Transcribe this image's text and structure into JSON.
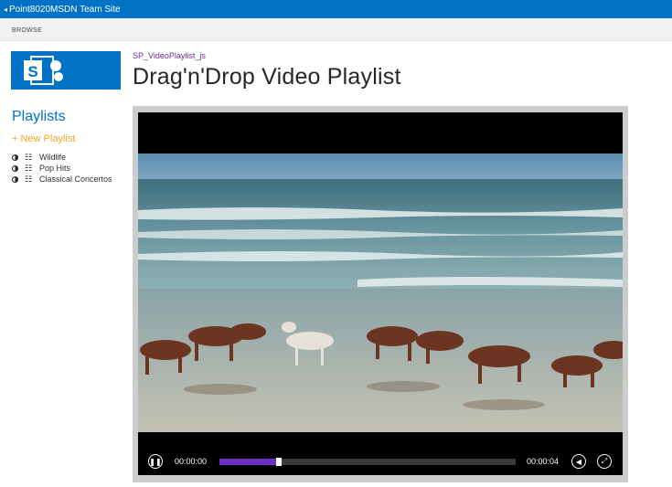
{
  "suite_bar": {
    "back_glyph": "◂",
    "site_title": "Point8020MSDN Team Site"
  },
  "ribbon": {
    "tab_label": "BROWSE"
  },
  "header": {
    "breadcrumb": "SP_VideoPlaylist_js",
    "title": "Drag'n'Drop Video Playlist"
  },
  "logo": {
    "icon": "sharepoint-logo-icon",
    "brand_color": "#0072c6"
  },
  "nav": {
    "heading": "Playlists",
    "new_link": "+ New Playlist",
    "playlists": [
      {
        "label": "Wildlife",
        "play_icon": "play-icon",
        "edit_icon": "edit-playlist-icon"
      },
      {
        "label": "Pop Hits",
        "play_icon": "play-icon",
        "edit_icon": "edit-playlist-icon"
      },
      {
        "label": "Classical Concertos",
        "play_icon": "play-icon",
        "edit_icon": "edit-playlist-icon"
      }
    ]
  },
  "player": {
    "current_time": "00:00:00",
    "duration": "00:00:04",
    "buffered_fraction": 0.19,
    "played_fraction": 0.19,
    "pause_icon": "pause-icon",
    "volume_icon": "volume-icon",
    "fullscreen_icon": "fullscreen-icon",
    "progress_color": "#6b2fc4"
  },
  "colors": {
    "accent": "#0072c6",
    "link": "#6a2c91",
    "new_link": "#f7a524"
  }
}
